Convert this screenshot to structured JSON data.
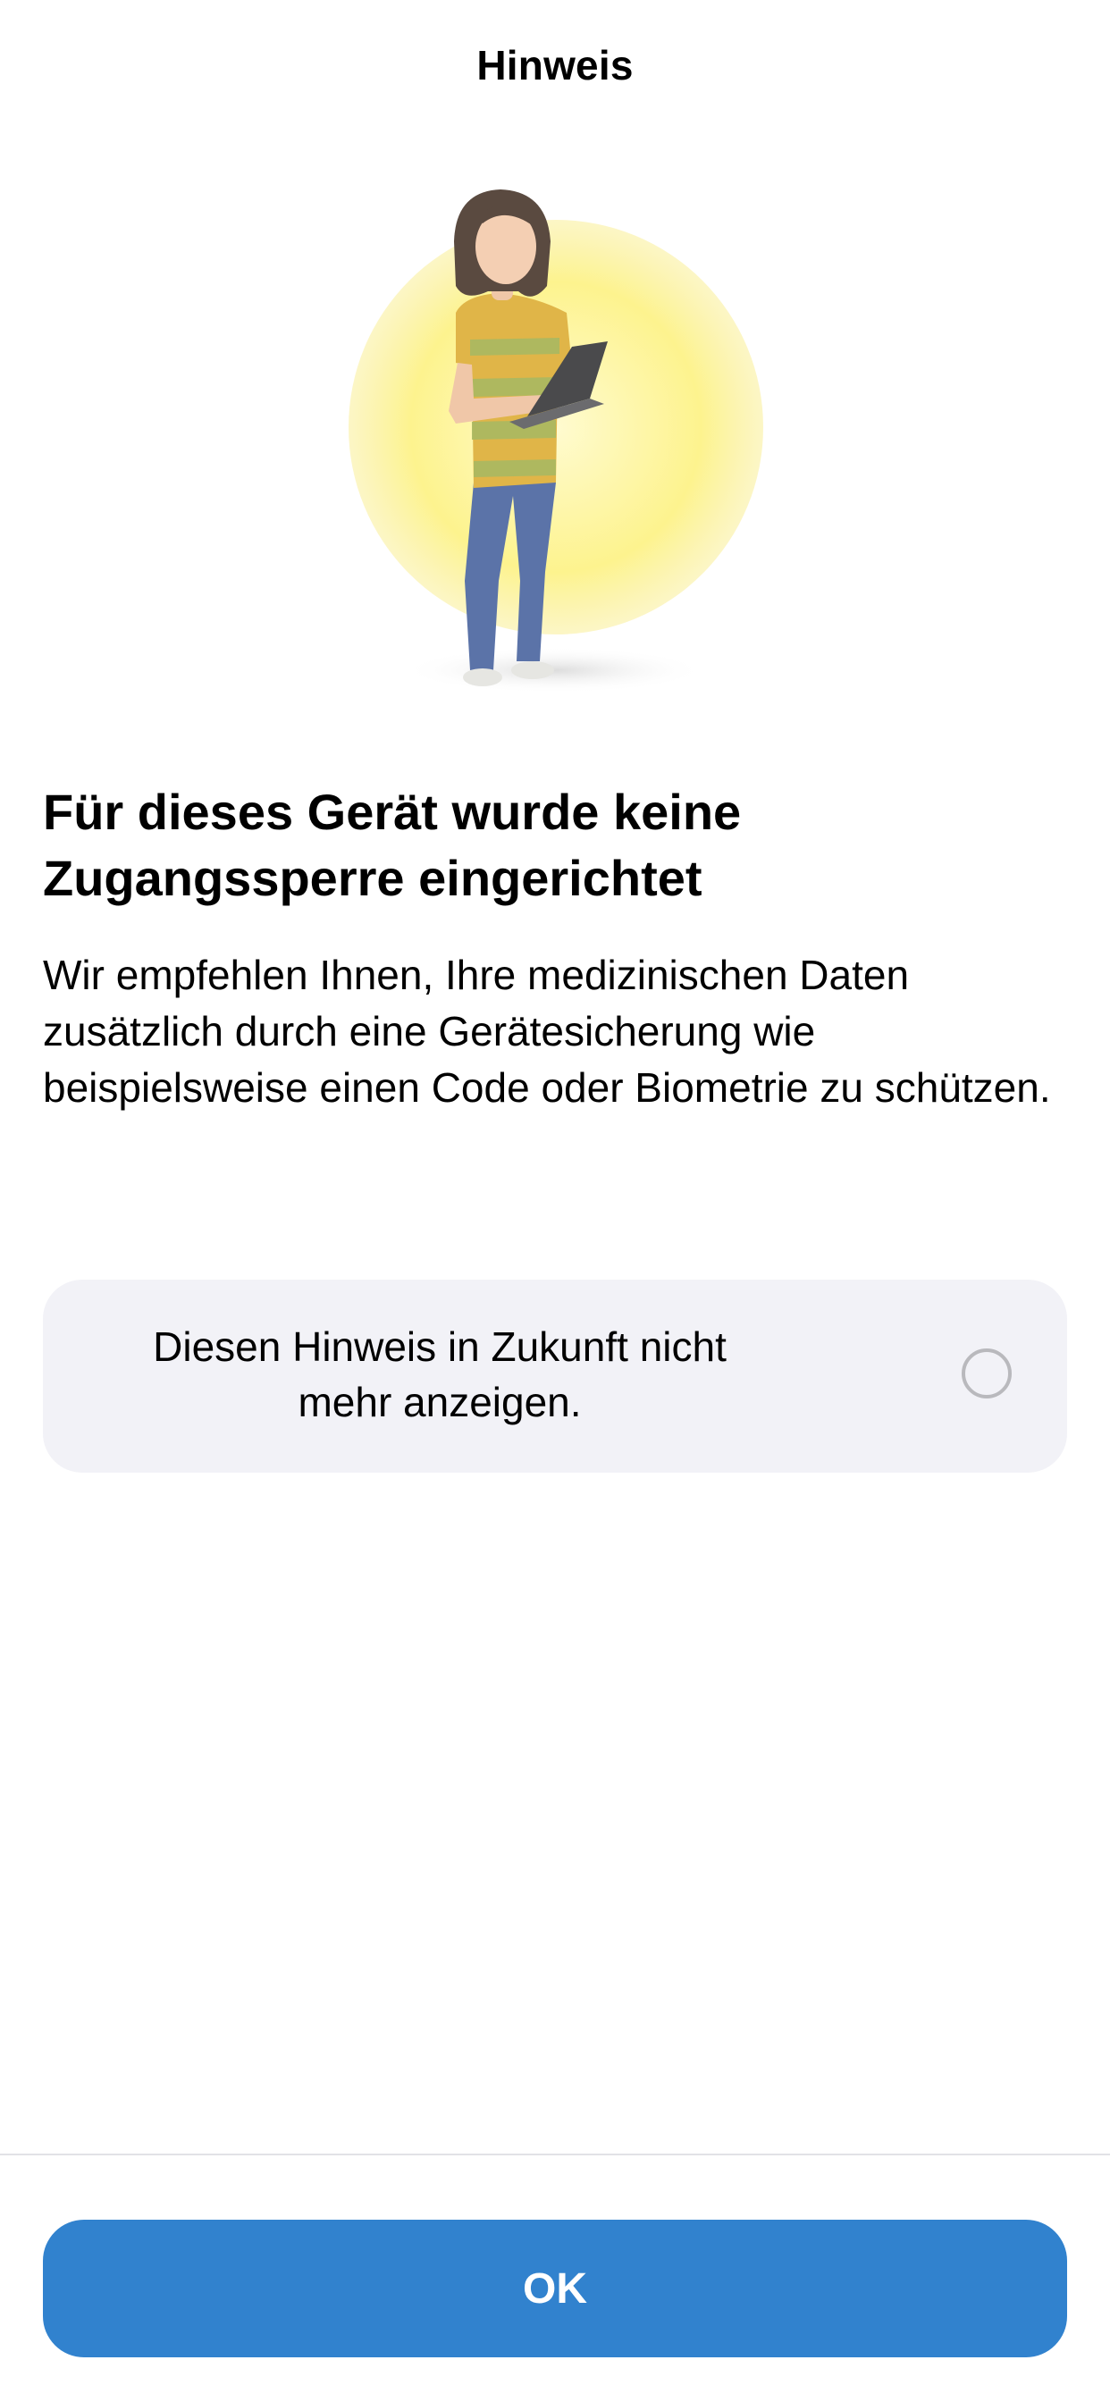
{
  "nav": {
    "title": "Hinweis"
  },
  "illustration": {
    "subject": "woman-with-laptop",
    "background_color": "#fbf088"
  },
  "main": {
    "headline": "Für dieses Gerät wurde keine Zugangssperre eingerichtet",
    "description": "Wir empfehlen Ihnen, Ihre medizinischen Daten zusätzlich durch eine Gerätesicherung wie beispielsweise einen Code oder Biometrie zu schützen."
  },
  "opt_out": {
    "label_line1": "Diesen Hinweis in Zukunft nicht",
    "label_line2": "mehr anzeigen.",
    "checked": false
  },
  "footer": {
    "ok_label": "OK",
    "accent_color": "#3182ce"
  }
}
